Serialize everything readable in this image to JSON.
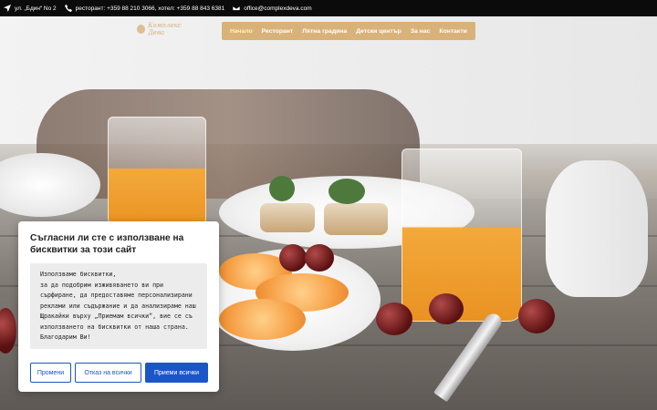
{
  "topbar": {
    "address": "ул. „Бдин“ No 2",
    "phones": "ресторант: +359 88 210 3066, хотел: +359 88 843 6381",
    "email": "office@complexdeva.com",
    "icons": [
      "location-arrow-icon",
      "phone-icon",
      "envelope-icon"
    ]
  },
  "logo": {
    "text": "Комплекс Дева"
  },
  "nav": {
    "accent": "#d9b27a",
    "items": [
      "Начало",
      "Ресторант",
      "Лятна градина",
      "Детски център",
      "За нас",
      "Контакти"
    ],
    "active": "Начало"
  },
  "cookie": {
    "title": "Съгласни ли сте с използване на бисквитки за този сайт",
    "body": [
      "Използваме бисквитки,",
      "за да подобрим изживяването ви при",
      "сърфиране, да предоставяме персонализирани",
      "реклами или съдържание и да анализираме наш",
      "Щракайки върху „Приемам всички“, вие се съ",
      "използването на бисквитки от наша страна.",
      "Благодарим Ви!"
    ],
    "buttons": {
      "change": "Промени",
      "reject": "Отказ на всички",
      "accept": "Приеми всички"
    },
    "button_color": "#1a56c8"
  }
}
